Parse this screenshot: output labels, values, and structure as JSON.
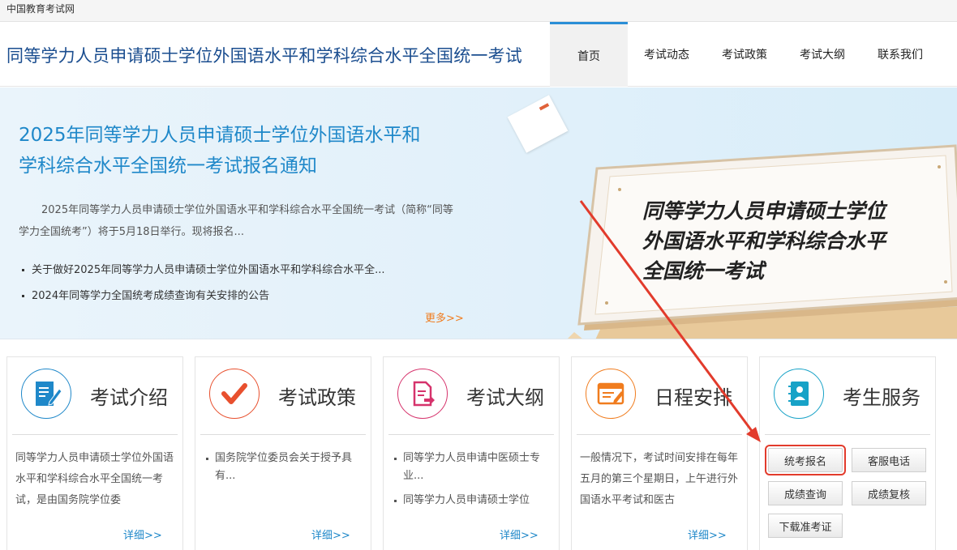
{
  "topbar": {
    "site_name": "中国教育考试网"
  },
  "header": {
    "title": "同等学力人员申请硕士学位外国语水平和学科综合水平全国统一考试",
    "nav": [
      "首页",
      "考试动态",
      "考试政策",
      "考试大纲",
      "联系我们"
    ],
    "active_nav": "首页"
  },
  "banner": {
    "headline_line1": "2025年同等学力人员申请硕士学位外国语水平和",
    "headline_line2": "学科综合水平全国统一考试报名通知",
    "summary": "2025年同等学力人员申请硕士学位外国语水平和学科综合水平全国统一考试（简称“同等学力全国统考”）将于5月18日举行。现将报名...",
    "news": [
      "关于做好2025年同等学力人员申请硕士学位外国语水平和学科综合水平全...",
      "2024年同等学力全国统考成绩查询有关安排的公告"
    ],
    "more": "更多>>",
    "sign_line1": "同等学力人员申请硕士学位",
    "sign_line2": "外国语水平和学科综合水平",
    "sign_line3": "全国统一考试"
  },
  "cards": {
    "intro": {
      "title": "考试介绍",
      "icon": "document-edit-icon",
      "text": "同等学力人员申请硕士学位外国语水平和学科综合水平全国统一考试，是由国务院学位委",
      "detail": "详细>>"
    },
    "policy": {
      "title": "考试政策",
      "icon": "checkmark-icon",
      "items": [
        "国务院学位委员会关于授予具有..."
      ],
      "detail": "详细>>"
    },
    "syllabus": {
      "title": "考试大纲",
      "icon": "document-arrow-icon",
      "items": [
        "同等学力人员申请中医硕士专业...",
        "同等学力人员申请硕士学位"
      ],
      "detail": "详细>>"
    },
    "schedule": {
      "title": "日程安排",
      "icon": "schedule-icon",
      "text": "一般情况下，考试时间安排在每年五月的第三个星期日，上午进行外国语水平考试和医古",
      "detail": "详细>>"
    },
    "service": {
      "title": "考生服务",
      "icon": "contact-book-icon",
      "buttons": [
        "统考报名",
        "客服电话",
        "成绩查询",
        "成绩复核",
        "下载准考证"
      ]
    }
  },
  "colors": {
    "primary_blue": "#1f88c9",
    "title_blue": "#1a4d8f",
    "accent_orange": "#f07c1e",
    "highlight_red": "#e23b2c"
  }
}
